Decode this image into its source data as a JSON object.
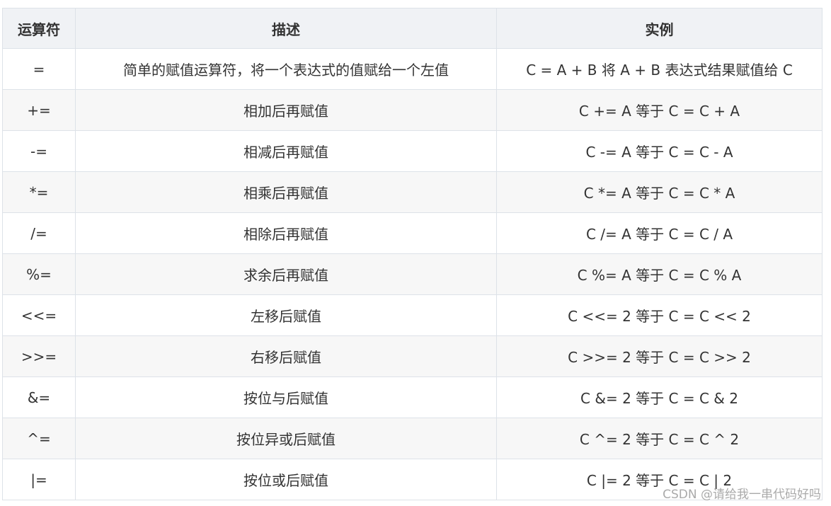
{
  "table": {
    "headers": [
      "运算符",
      "描述",
      "实例"
    ],
    "rows": [
      {
        "op": "=",
        "desc": "简单的赋值运算符，将一个表达式的值赋给一个左值",
        "example": "C = A + B 将 A + B 表达式结果赋值给 C"
      },
      {
        "op": "+=",
        "desc": "相加后再赋值",
        "example": "C += A 等于 C = C + A"
      },
      {
        "op": "-=",
        "desc": "相减后再赋值",
        "example": "C -= A 等于 C = C - A"
      },
      {
        "op": "*=",
        "desc": "相乘后再赋值",
        "example": "C *= A 等于 C = C * A"
      },
      {
        "op": "/=",
        "desc": "相除后再赋值",
        "example": "C /= A 等于 C = C / A"
      },
      {
        "op": "%=",
        "desc": "求余后再赋值",
        "example": "C %= A 等于 C = C % A"
      },
      {
        "op": "<<=",
        "desc": "左移后赋值",
        "example": "C <<= 2 等于 C = C << 2"
      },
      {
        "op": ">>=",
        "desc": "右移后赋值",
        "example": "C >>= 2 等于 C = C >> 2"
      },
      {
        "op": "&=",
        "desc": "按位与后赋值",
        "example": "C &= 2 等于 C = C & 2"
      },
      {
        "op": "^=",
        "desc": "按位异或后赋值",
        "example": "C ^= 2 等于 C = C ^ 2"
      },
      {
        "op": "|=",
        "desc": "按位或后赋值",
        "example": "C |= 2 等于 C = C | 2"
      }
    ]
  },
  "watermark": "CSDN @请给我一串代码好吗",
  "colors": {
    "header_bg": "#f0f2f5",
    "stripe_bg": "#f7f7f7",
    "border": "#dde2e8",
    "text": "#333333"
  }
}
